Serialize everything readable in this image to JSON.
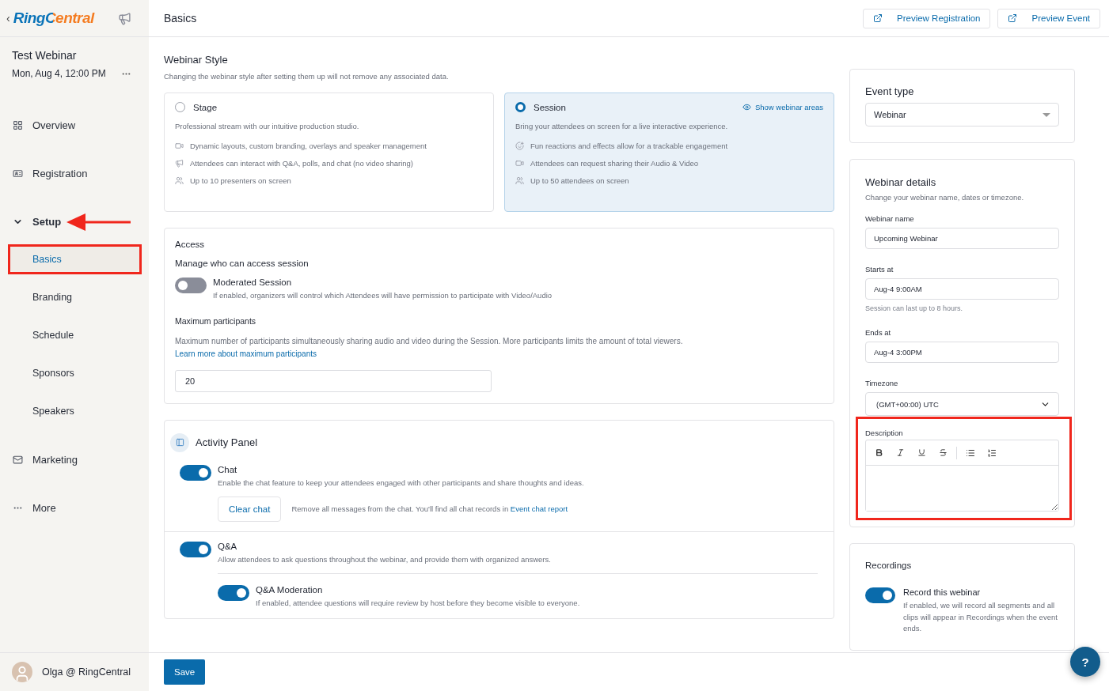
{
  "sidebar": {
    "back": "‹",
    "logo": "RingCentral",
    "event": {
      "title": "Test Webinar",
      "date": "Mon, Aug 4, 12:00 PM"
    },
    "nav": [
      {
        "label": "Overview",
        "expanded": false,
        "pointed": false
      },
      {
        "label": "Registration",
        "expanded": false,
        "pointed": false
      },
      {
        "label": "Setup",
        "expanded": true,
        "pointed": true,
        "children": [
          {
            "label": "Basics",
            "selected": true,
            "highlighted": true
          },
          {
            "label": "Branding",
            "selected": false,
            "highlighted": false
          },
          {
            "label": "Schedule",
            "selected": false,
            "highlighted": false
          },
          {
            "label": "Sponsors",
            "selected": false,
            "highlighted": false
          },
          {
            "label": "Speakers",
            "selected": false,
            "highlighted": false
          }
        ]
      },
      {
        "label": "Marketing",
        "expanded": false,
        "pointed": false
      },
      {
        "label": "More",
        "expanded": false,
        "pointed": false
      }
    ],
    "user": {
      "name": "Olga @ RingCentral"
    }
  },
  "header": {
    "title": "Basics",
    "buttons": [
      "Preview Registration",
      "Preview Event"
    ]
  },
  "webinar_style": {
    "title": "Webinar Style",
    "subtitle": "Changing the webinar style after setting them up will not remove any associated data.",
    "options": [
      {
        "title": "Stage",
        "selected": false,
        "description": "Professional stream with our intuitive production studio.",
        "features": [
          "Dynamic layouts, custom branding, overlays and speaker management",
          "Attendees can interact with Q&A, polls, and chat (no video sharing)",
          "Up to 10 presenters on screen"
        ]
      },
      {
        "title": "Session",
        "selected": true,
        "link": "Show webinar areas",
        "description": "Bring your attendees on screen for a live interactive experience.",
        "features": [
          "Fun reactions and effects allow for a trackable engagement",
          "Attendees can request sharing their Audio & Video",
          "Up to 50 attendees on screen"
        ]
      }
    ]
  },
  "access": {
    "title": "Access",
    "subtitle": "Manage who can access session",
    "toggle": {
      "label": "Moderated Session",
      "on": false,
      "description": "If enabled, organizers will control which Attendees will have permission to participate with Video/Audio"
    },
    "max_participants": {
      "title": "Maximum participants",
      "description": "Maximum number of participants simultaneously sharing audio and video during the Session. More participants limits the amount of total viewers.",
      "link": "Learn more about maximum participants",
      "value": "20"
    }
  },
  "activity_panel": {
    "title": "Activity Panel",
    "items": [
      {
        "label": "Chat",
        "on": true,
        "description": "Enable the chat feature to keep your attendees engaged with other participants and share thoughts and ideas.",
        "action": {
          "button": "Clear chat",
          "text": "Remove all messages from the chat. You'll find all chat records in",
          "link": "Event chat report"
        }
      },
      {
        "label": "Q&A",
        "on": true,
        "description": "Allow attendees to ask questions throughout the webinar, and provide them with organized answers.",
        "children": [
          {
            "label": "Q&A Moderation",
            "on": true,
            "description": "If enabled, attendee questions will require review by host before they become visible to everyone."
          }
        ]
      }
    ]
  },
  "event_type": {
    "title": "Event type",
    "value": "Webinar"
  },
  "webinar_details": {
    "title": "Webinar details",
    "subtitle": "Change your webinar name, dates or timezone.",
    "fields": [
      {
        "label": "Webinar name",
        "value": "Upcoming Webinar",
        "kind": "input"
      },
      {
        "label": "Starts at",
        "value": "Aug-4 9:00AM",
        "kind": "input",
        "hint": "Session can last up to 8 hours."
      },
      {
        "label": "Ends at",
        "value": "Aug-4 3:00PM",
        "kind": "input"
      },
      {
        "label": "Timezone",
        "value": "(GMT+00:00) UTC",
        "kind": "select"
      }
    ],
    "description": {
      "label": "Description",
      "highlighted": true
    }
  },
  "recordings": {
    "title": "Recordings",
    "toggle": {
      "label": "Record this webinar",
      "on": true,
      "description": "If enabled, we will record all segments and all clips will appear in Recordings when the event ends."
    }
  },
  "footer": {
    "save": "Save",
    "help": "?"
  }
}
